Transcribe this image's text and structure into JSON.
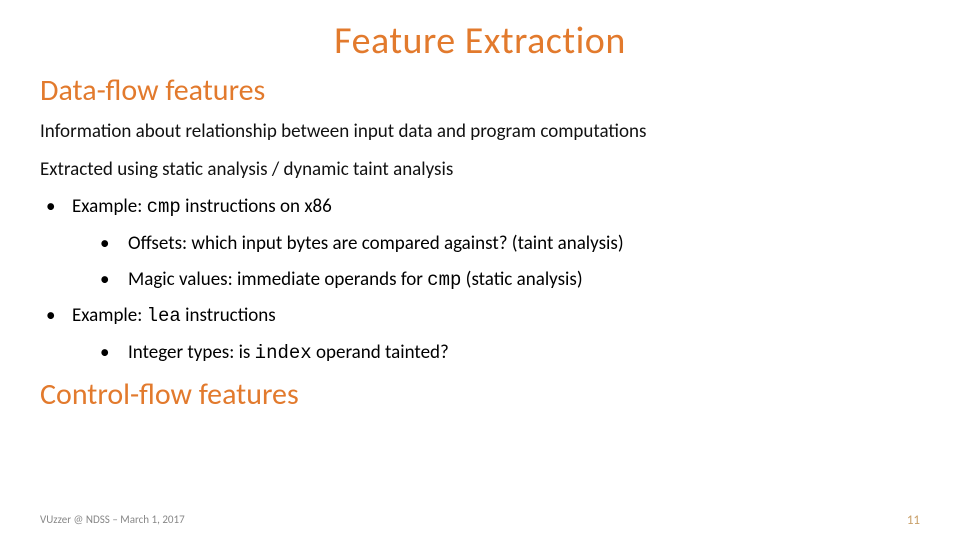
{
  "title": "Feature Extraction",
  "section1": "Data-flow features",
  "para1": "Information about relationship between input data and program computations",
  "para2": "Extracted using static analysis / dynamic taint analysis",
  "ex1_pre": "Example: ",
  "ex1_code": "cmp",
  "ex1_post": " instructions on x86",
  "ex1_sub1": "Offsets: which input bytes are compared against? (taint analysis)",
  "ex1_sub2_pre": "Magic values: immediate operands for ",
  "ex1_sub2_code": "cmp",
  "ex1_sub2_post": " (static analysis)",
  "ex2_pre": "Example: ",
  "ex2_code": "lea",
  "ex2_post": " instructions",
  "ex2_sub1_pre": "Integer types: is ",
  "ex2_sub1_code": "index",
  "ex2_sub1_post": " operand tainted?",
  "section2": "Control-flow features",
  "footer_left": "VUzzer @ NDSS – March 1, 2017",
  "page_number": "11"
}
